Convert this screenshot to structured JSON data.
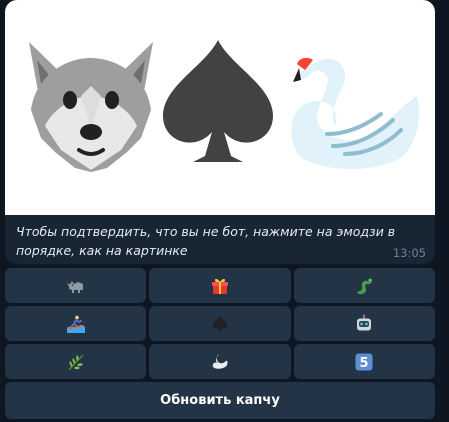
{
  "message": {
    "caption": "Чтобы подтвердить, что вы не бот, нажмите на эмодзи в порядке, как на картинке",
    "time": "13:05",
    "image_icons": [
      "wolf-icon",
      "spade-icon",
      "swan-icon"
    ]
  },
  "keyboard": {
    "rows": [
      [
        "rhino-icon",
        "gift-icon",
        "dragon-icon"
      ],
      [
        "person-surfing-icon",
        "spade-icon",
        "robot-icon"
      ],
      [
        "herb-icon",
        "swan-icon",
        "keycap-5-icon"
      ]
    ],
    "refresh_label": "Обновить капчу",
    "keycap_digit": "5"
  },
  "colors": {
    "background": "#0e1621",
    "bubble": "#182533",
    "button": "#243447",
    "caption_text": "#e4ecf2",
    "time_text": "#6d8297"
  }
}
